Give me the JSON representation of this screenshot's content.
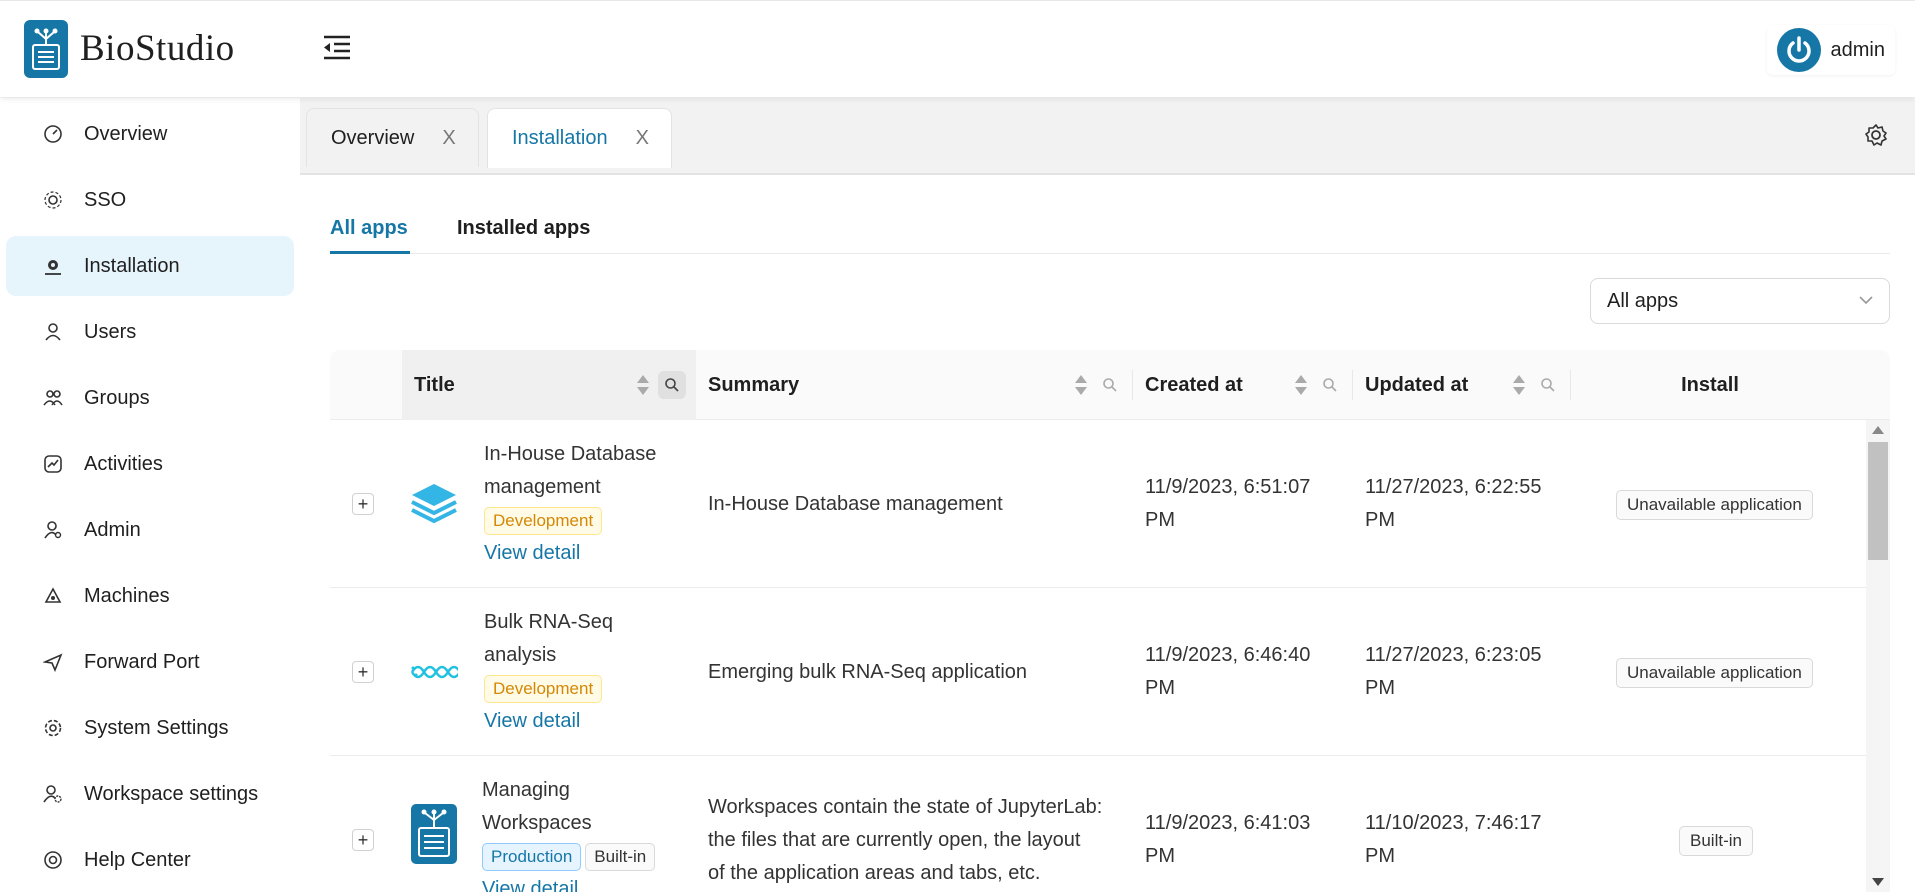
{
  "app": {
    "brand": "BioStudio",
    "user": "admin"
  },
  "sidebar": {
    "items": [
      {
        "label": "Overview",
        "icon": "dashboard-icon",
        "active": false
      },
      {
        "label": "SSO",
        "icon": "sso-icon",
        "active": false
      },
      {
        "label": "Installation",
        "icon": "install-gear-icon",
        "active": true
      },
      {
        "label": "Users",
        "icon": "user-icon",
        "active": false
      },
      {
        "label": "Groups",
        "icon": "groups-icon",
        "active": false
      },
      {
        "label": "Activities",
        "icon": "activity-icon",
        "active": false
      },
      {
        "label": "Admin",
        "icon": "admin-icon",
        "active": false
      },
      {
        "label": "Machines",
        "icon": "machines-icon",
        "active": false
      },
      {
        "label": "Forward Port",
        "icon": "send-icon",
        "active": false
      },
      {
        "label": "System Settings",
        "icon": "settings-icon",
        "active": false
      },
      {
        "label": "Workspace settings",
        "icon": "workspace-settings-icon",
        "active": false
      },
      {
        "label": "Help Center",
        "icon": "help-icon",
        "active": false
      }
    ]
  },
  "page_tabs": [
    {
      "label": "Overview",
      "close": "X",
      "active": false
    },
    {
      "label": "Installation",
      "close": "X",
      "active": true
    }
  ],
  "subtabs": [
    {
      "label": "All apps",
      "active": true
    },
    {
      "label": "Installed apps",
      "active": false
    }
  ],
  "filter": {
    "value": "All apps"
  },
  "table": {
    "columns": [
      "Title",
      "Summary",
      "Created at",
      "Updated at",
      "Install"
    ],
    "rows": [
      {
        "title_line1": "In-House Database",
        "title_line2": "management",
        "tags": [
          "Development"
        ],
        "link": "View detail",
        "summary": "In-House Database management",
        "created_1": "11/9/2023, 6:51:07",
        "created_2": "PM",
        "updated_1": "11/27/2023, 6:22:55",
        "updated_2": "PM",
        "install": "Unavailable application",
        "icon": "database-layers-icon"
      },
      {
        "title_line1": "Bulk RNA-Seq",
        "title_line2": "analysis",
        "tags": [
          "Development"
        ],
        "link": "View detail",
        "summary": "Emerging bulk RNA-Seq application",
        "created_1": "11/9/2023, 6:46:40",
        "created_2": "PM",
        "updated_1": "11/27/2023, 6:23:05",
        "updated_2": "PM",
        "install": "Unavailable application",
        "icon": "dna-helix-icon"
      },
      {
        "title_line1": "Managing",
        "title_line2": "Workspaces",
        "tags": [
          "Production",
          "Built-in"
        ],
        "link": "View detail",
        "summary_1": "Workspaces contain the state of JupyterLab:",
        "summary_2": "the files that are currently open, the layout",
        "summary_3": "of the application areas and tabs, etc.",
        "created_1": "11/9/2023, 6:41:03",
        "created_2": "PM",
        "updated_1": "11/10/2023, 7:46:17",
        "updated_2": "PM",
        "install": "Built-in",
        "icon": "biostudio-logo-icon"
      }
    ]
  },
  "colors": {
    "accent": "#1677a6",
    "active_bg": "#e6f4fc",
    "dev_tag": "#d48806",
    "prod_tag": "#1677a6"
  }
}
